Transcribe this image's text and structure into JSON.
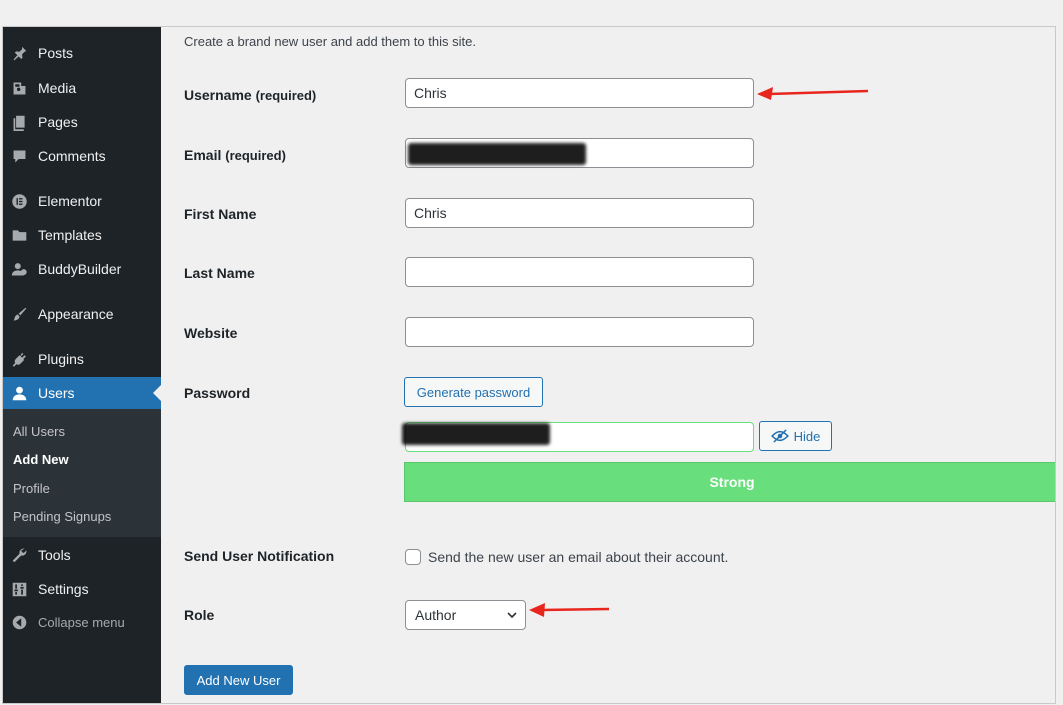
{
  "sidebar": {
    "items": [
      {
        "label": "Posts",
        "icon": "pushpin-icon"
      },
      {
        "label": "Media",
        "icon": "media-icon"
      },
      {
        "label": "Pages",
        "icon": "pages-icon"
      },
      {
        "label": "Comments",
        "icon": "comment-icon"
      },
      {
        "label": "Elementor",
        "icon": "elementor-icon"
      },
      {
        "label": "Templates",
        "icon": "folder-icon"
      },
      {
        "label": "BuddyBuilder",
        "icon": "buddybuilder-icon"
      },
      {
        "label": "Appearance",
        "icon": "paintbrush-icon"
      },
      {
        "label": "Plugins",
        "icon": "plug-icon"
      },
      {
        "label": "Users",
        "icon": "user-icon"
      },
      {
        "label": "Tools",
        "icon": "wrench-icon"
      },
      {
        "label": "Settings",
        "icon": "sliders-icon"
      }
    ],
    "users_submenu": [
      "All Users",
      "Add New",
      "Profile",
      "Pending Signups"
    ],
    "collapse_label": "Collapse menu"
  },
  "form": {
    "intro": "Create a brand new user and add them to this site.",
    "username_label": "Username",
    "username_req": "(required)",
    "username_value": "Chris",
    "email_label": "Email",
    "email_req": "(required)",
    "first_name_label": "First Name",
    "first_name_value": "Chris",
    "last_name_label": "Last Name",
    "last_name_value": "",
    "website_label": "Website",
    "website_value": "",
    "password_label": "Password",
    "generate_password": "Generate password",
    "hide_label": "Hide",
    "strength": "Strong",
    "notification_label": "Send User Notification",
    "notification_text": "Send the new user an email about their account.",
    "role_label": "Role",
    "role_value": "Author",
    "submit": "Add New User"
  },
  "colors": {
    "sidebar_bg": "#1d2327",
    "accent": "#2271b1",
    "strength_green": "#68de7c",
    "annotation_arrow": "#e8261d"
  }
}
